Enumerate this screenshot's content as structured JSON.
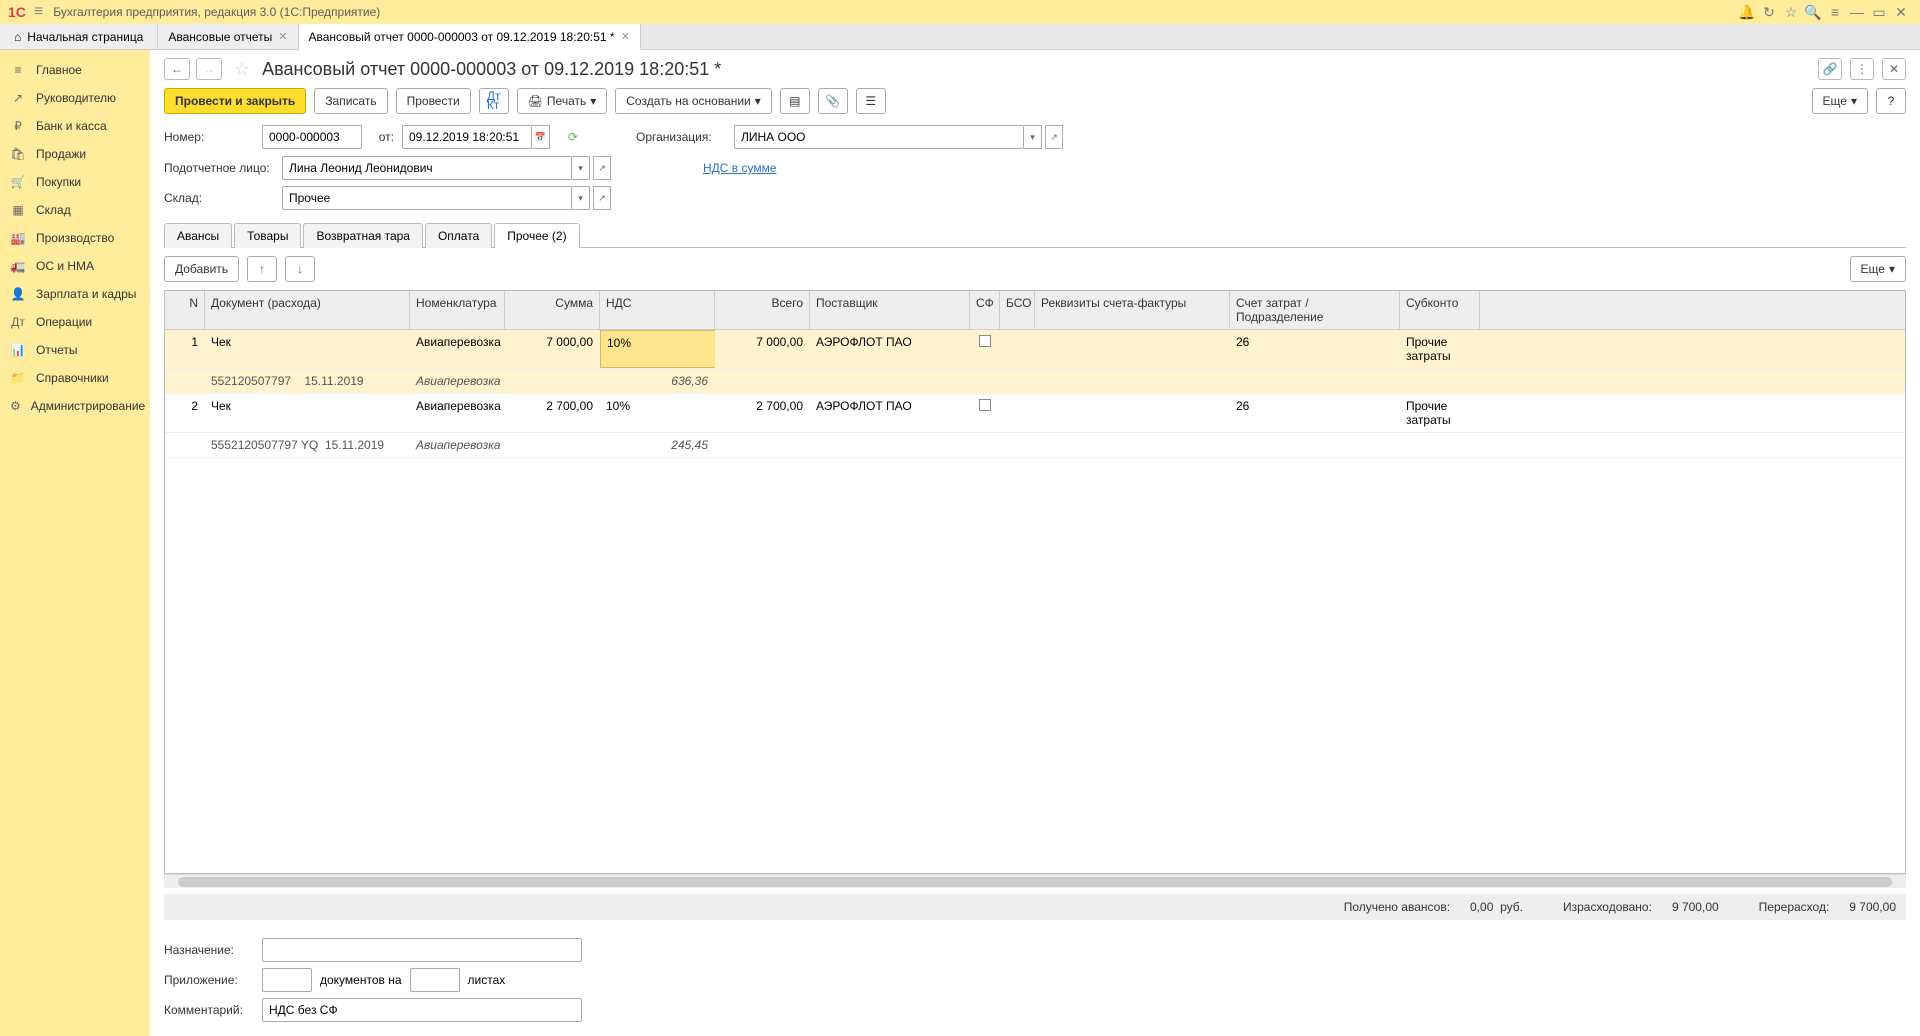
{
  "app": {
    "title": "Бухгалтерия предприятия, редакция 3.0  (1С:Предприятие)"
  },
  "tabs": {
    "home": "Начальная страница",
    "items": [
      {
        "label": "Авансовые отчеты",
        "active": false
      },
      {
        "label": "Авансовый отчет 0000-000003 от 09.12.2019 18:20:51 *",
        "active": true
      }
    ]
  },
  "sidebar": [
    {
      "icon": "≡",
      "label": "Главное"
    },
    {
      "icon": "↗",
      "label": "Руководителю"
    },
    {
      "icon": "₽",
      "label": "Банк и касса"
    },
    {
      "icon": "🛍",
      "label": "Продажи"
    },
    {
      "icon": "🛒",
      "label": "Покупки"
    },
    {
      "icon": "▦",
      "label": "Склад"
    },
    {
      "icon": "🏭",
      "label": "Производство"
    },
    {
      "icon": "🚛",
      "label": "ОС и НМА"
    },
    {
      "icon": "👤",
      "label": "Зарплата и кадры"
    },
    {
      "icon": "Дт",
      "label": "Операции"
    },
    {
      "icon": "📊",
      "label": "Отчеты"
    },
    {
      "icon": "📁",
      "label": "Справочники"
    },
    {
      "icon": "⚙",
      "label": "Администрирование"
    }
  ],
  "doc": {
    "title": "Авансовый отчет 0000-000003 от 09.12.2019 18:20:51 *"
  },
  "toolbar": {
    "primary": "Провести и закрыть",
    "save": "Записать",
    "post": "Провести",
    "print": "Печать",
    "create_based": "Создать на основании",
    "more": "Еще"
  },
  "fields": {
    "number_label": "Номер:",
    "number": "0000-000003",
    "from_label": "от:",
    "date": "09.12.2019 18:20:51",
    "org_label": "Организация:",
    "org": "ЛИНА ООО",
    "person_label": "Подотчетное лицо:",
    "person": "Лина Леонид Леонидович",
    "nds_link": "НДС в сумме",
    "wh_label": "Склад:",
    "wh": "Прочее"
  },
  "tabs2": [
    {
      "label": "Авансы"
    },
    {
      "label": "Товары"
    },
    {
      "label": "Возвратная тара"
    },
    {
      "label": "Оплата"
    },
    {
      "label": "Прочее (2)",
      "active": true
    }
  ],
  "subbar": {
    "add": "Добавить",
    "more": "Еще"
  },
  "grid": {
    "headers": {
      "n": "N",
      "doc": "Документ (расхода)",
      "nom": "Номенклатура",
      "sum": "Сумма",
      "nds": "НДС",
      "tot": "Всего",
      "sup": "Поставщик",
      "sf": "СФ",
      "bso": "БСО",
      "req": "Реквизиты счета-фактуры",
      "acc": "Счет затрат / Подразделение",
      "sub": "Субконто"
    },
    "rows": [
      {
        "n": "1",
        "doc": "Чек",
        "nom": "Авиаперевозка",
        "sum": "7 000,00",
        "nds": "10%",
        "tot": "7 000,00",
        "sup": "АЭРОФЛОТ ПАО",
        "acc": "26",
        "sub": "Прочие затраты",
        "selected": true,
        "sub2": {
          "doc": "552120507797",
          "date": "15.11.2019",
          "nom": "Авиаперевозка",
          "nds": "636,36"
        }
      },
      {
        "n": "2",
        "doc": "Чек",
        "nom": "Авиаперевозка",
        "sum": "2 700,00",
        "nds": "10%",
        "tot": "2 700,00",
        "sup": "АЭРОФЛОТ ПАО",
        "acc": "26",
        "sub": "Прочие затраты",
        "sub2": {
          "doc": "5552120507797 YQ",
          "date": "15.11.2019",
          "nom": "Авиаперевозка",
          "nds": "245,45"
        }
      }
    ]
  },
  "totals": {
    "adv_label": "Получено авансов:",
    "adv": "0,00",
    "cur": "руб.",
    "spent_label": "Израсходовано:",
    "spent": "9 700,00",
    "over_label": "Перерасход:",
    "over": "9 700,00"
  },
  "bottom": {
    "purpose_label": "Назначение:",
    "purpose": "",
    "app_label": "Приложение:",
    "app_docs": "",
    "app_mid": "документов на",
    "app_sheets": "",
    "app_end": "листах",
    "comment_label": "Комментарий:",
    "comment": "НДС без СФ"
  }
}
